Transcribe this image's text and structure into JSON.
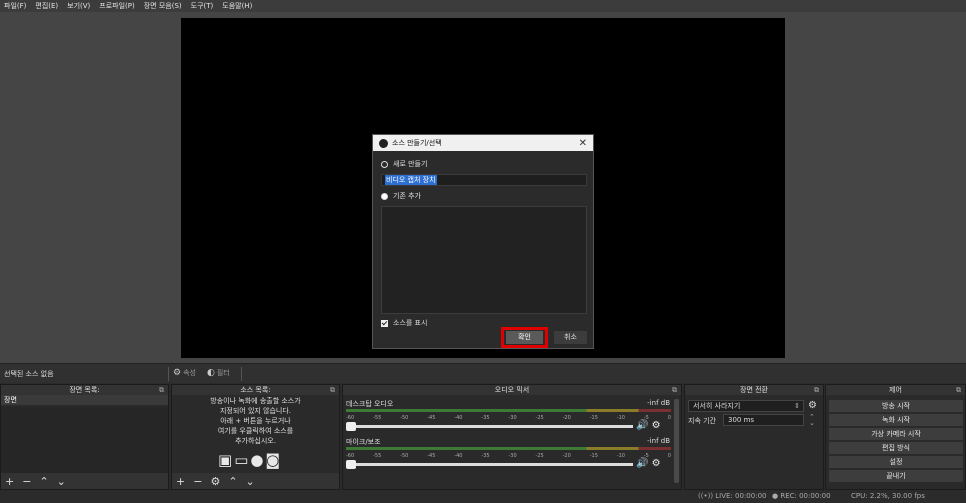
{
  "menu": [
    "파일(F)",
    "편집(E)",
    "보기(V)",
    "프로파일(P)",
    "장면 모음(S)",
    "도구(T)",
    "도움말(H)"
  ],
  "dialog": {
    "title": "소스 만들기/선택",
    "create_new_label": "새로 만들기",
    "name_value": "비디오 캡처 장치",
    "add_existing_label": "기존 추가",
    "show_source_label": "소스를 표시",
    "ok_label": "확인",
    "cancel_label": "취소"
  },
  "source_toolbar": {
    "no_source": "선택된 소스 없음",
    "properties": "속성",
    "filters": "필터"
  },
  "scenes": {
    "title": "장면 목록",
    "items": [
      "장면"
    ]
  },
  "sources": {
    "title": "소스 목록",
    "help_lines": [
      "방송이나 녹화에 송출할 소스가",
      "지정되어 있지 않습니다.",
      "아래 + 버튼을 누르거나",
      "여기를 우클릭하여 소스를",
      "추가하십시오."
    ]
  },
  "mixer": {
    "title": "오디오 믹서",
    "channels": [
      {
        "name": "데스크탑 오디오",
        "db": "-inf dB"
      },
      {
        "name": "마이크/보조",
        "db": "-inf dB"
      }
    ],
    "ticks": [
      "-60",
      "-55",
      "-50",
      "-45",
      "-40",
      "-35",
      "-30",
      "-25",
      "-20",
      "-15",
      "-10",
      "-5",
      "0"
    ]
  },
  "transitions": {
    "title": "장면 전환",
    "selected": "서서히 사라지기",
    "duration_label": "지속 기간",
    "duration_value": "300 ms"
  },
  "controls": {
    "title": "제어",
    "buttons": [
      "방송 시작",
      "녹화 시작",
      "가상 카메라 시작",
      "편집 방식",
      "설정",
      "끝내기"
    ]
  },
  "status": {
    "live": "LIVE: 00:00:00",
    "rec": "REC: 00:00:00",
    "cpu": "CPU: 2.2%, 30.00 fps"
  },
  "colors": {
    "highlight": "#e00000",
    "selection": "#2d6fd3"
  }
}
